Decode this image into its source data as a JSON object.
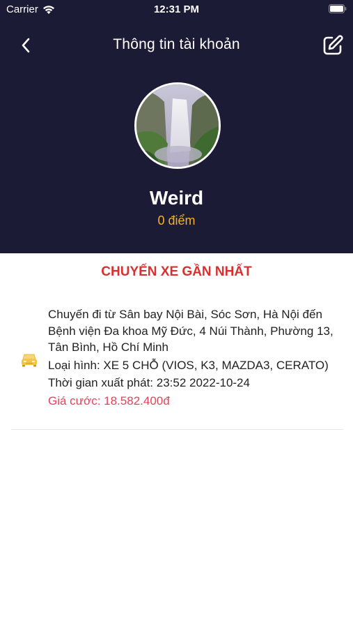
{
  "status_bar": {
    "carrier": "Carrier",
    "time": "12:31 PM"
  },
  "nav": {
    "title": "Thông tin tài khoản",
    "back_icon": "chevron-left-icon",
    "edit_icon": "edit-icon"
  },
  "profile": {
    "name": "Weird",
    "points": "0 điểm"
  },
  "recent_trip": {
    "section_title": "CHUYẾN XE GẦN NHẤT",
    "route": "Chuyến đi từ Sân bay Nội Bài, Sóc Sơn, Hà Nội đến Bệnh viện Đa khoa Mỹ Đức, 4 Núi Thành, Phường 13, Tân Bình, Hồ Chí Minh",
    "vehicle_type": "Loại hình: XE 5 CHỖ (VIOS, K3, MAZDA3, CERATO)",
    "departure_time": "Thời gian xuất phát: 23:52 2022-10-24",
    "price": "Giá cước: 18.582.400đ",
    "icon": "car-icon"
  },
  "colors": {
    "header_bg": "#1b1b36",
    "points": "#f2b12d",
    "section_title": "#d9302f",
    "price": "#e8415a"
  }
}
